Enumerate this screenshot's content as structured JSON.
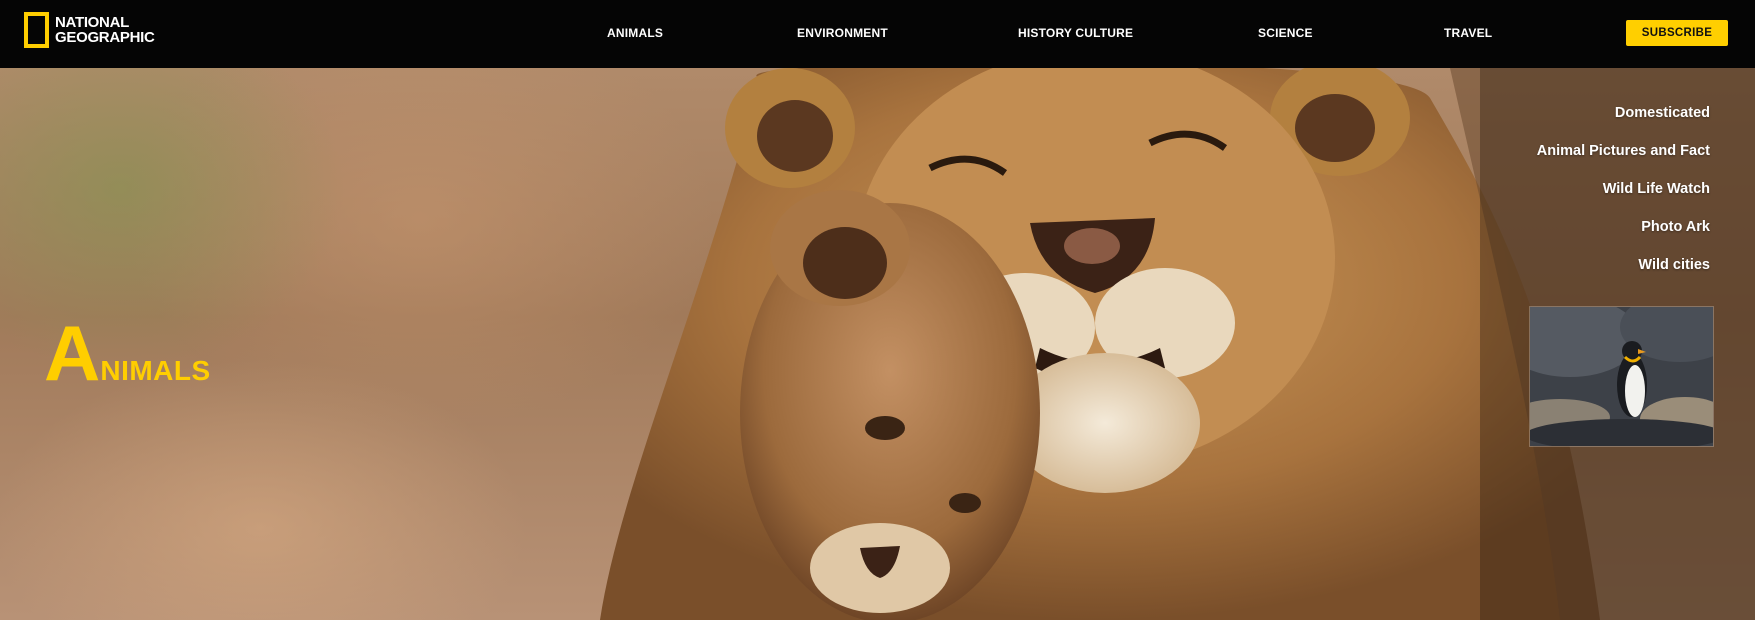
{
  "header": {
    "logo": {
      "line1": "NATIONAL",
      "line2": "GEOGRAPHIC"
    },
    "nav": [
      {
        "label": "ANIMALS"
      },
      {
        "label": "ENVIRONMENT"
      },
      {
        "label": "HISTORY CULTURE"
      },
      {
        "label": "SCIENCE"
      },
      {
        "label": "TRAVEL"
      }
    ],
    "subscribe_label": "SUBSCRIBE"
  },
  "hero": {
    "title_initial": "A",
    "title_rest": "NIMALS",
    "image_subject": "lioness-and-cub-photo"
  },
  "submenu": {
    "items": [
      {
        "label": "Domesticated"
      },
      {
        "label": "Animal Pictures and Fact"
      },
      {
        "label": "Wild Life Watch"
      },
      {
        "label": "Photo Ark"
      },
      {
        "label": "Wild cities"
      }
    ],
    "thumbnail_subject": "penguin-photo"
  },
  "colors": {
    "brand_yellow": "#ffce00",
    "header_bg": "#050505"
  }
}
